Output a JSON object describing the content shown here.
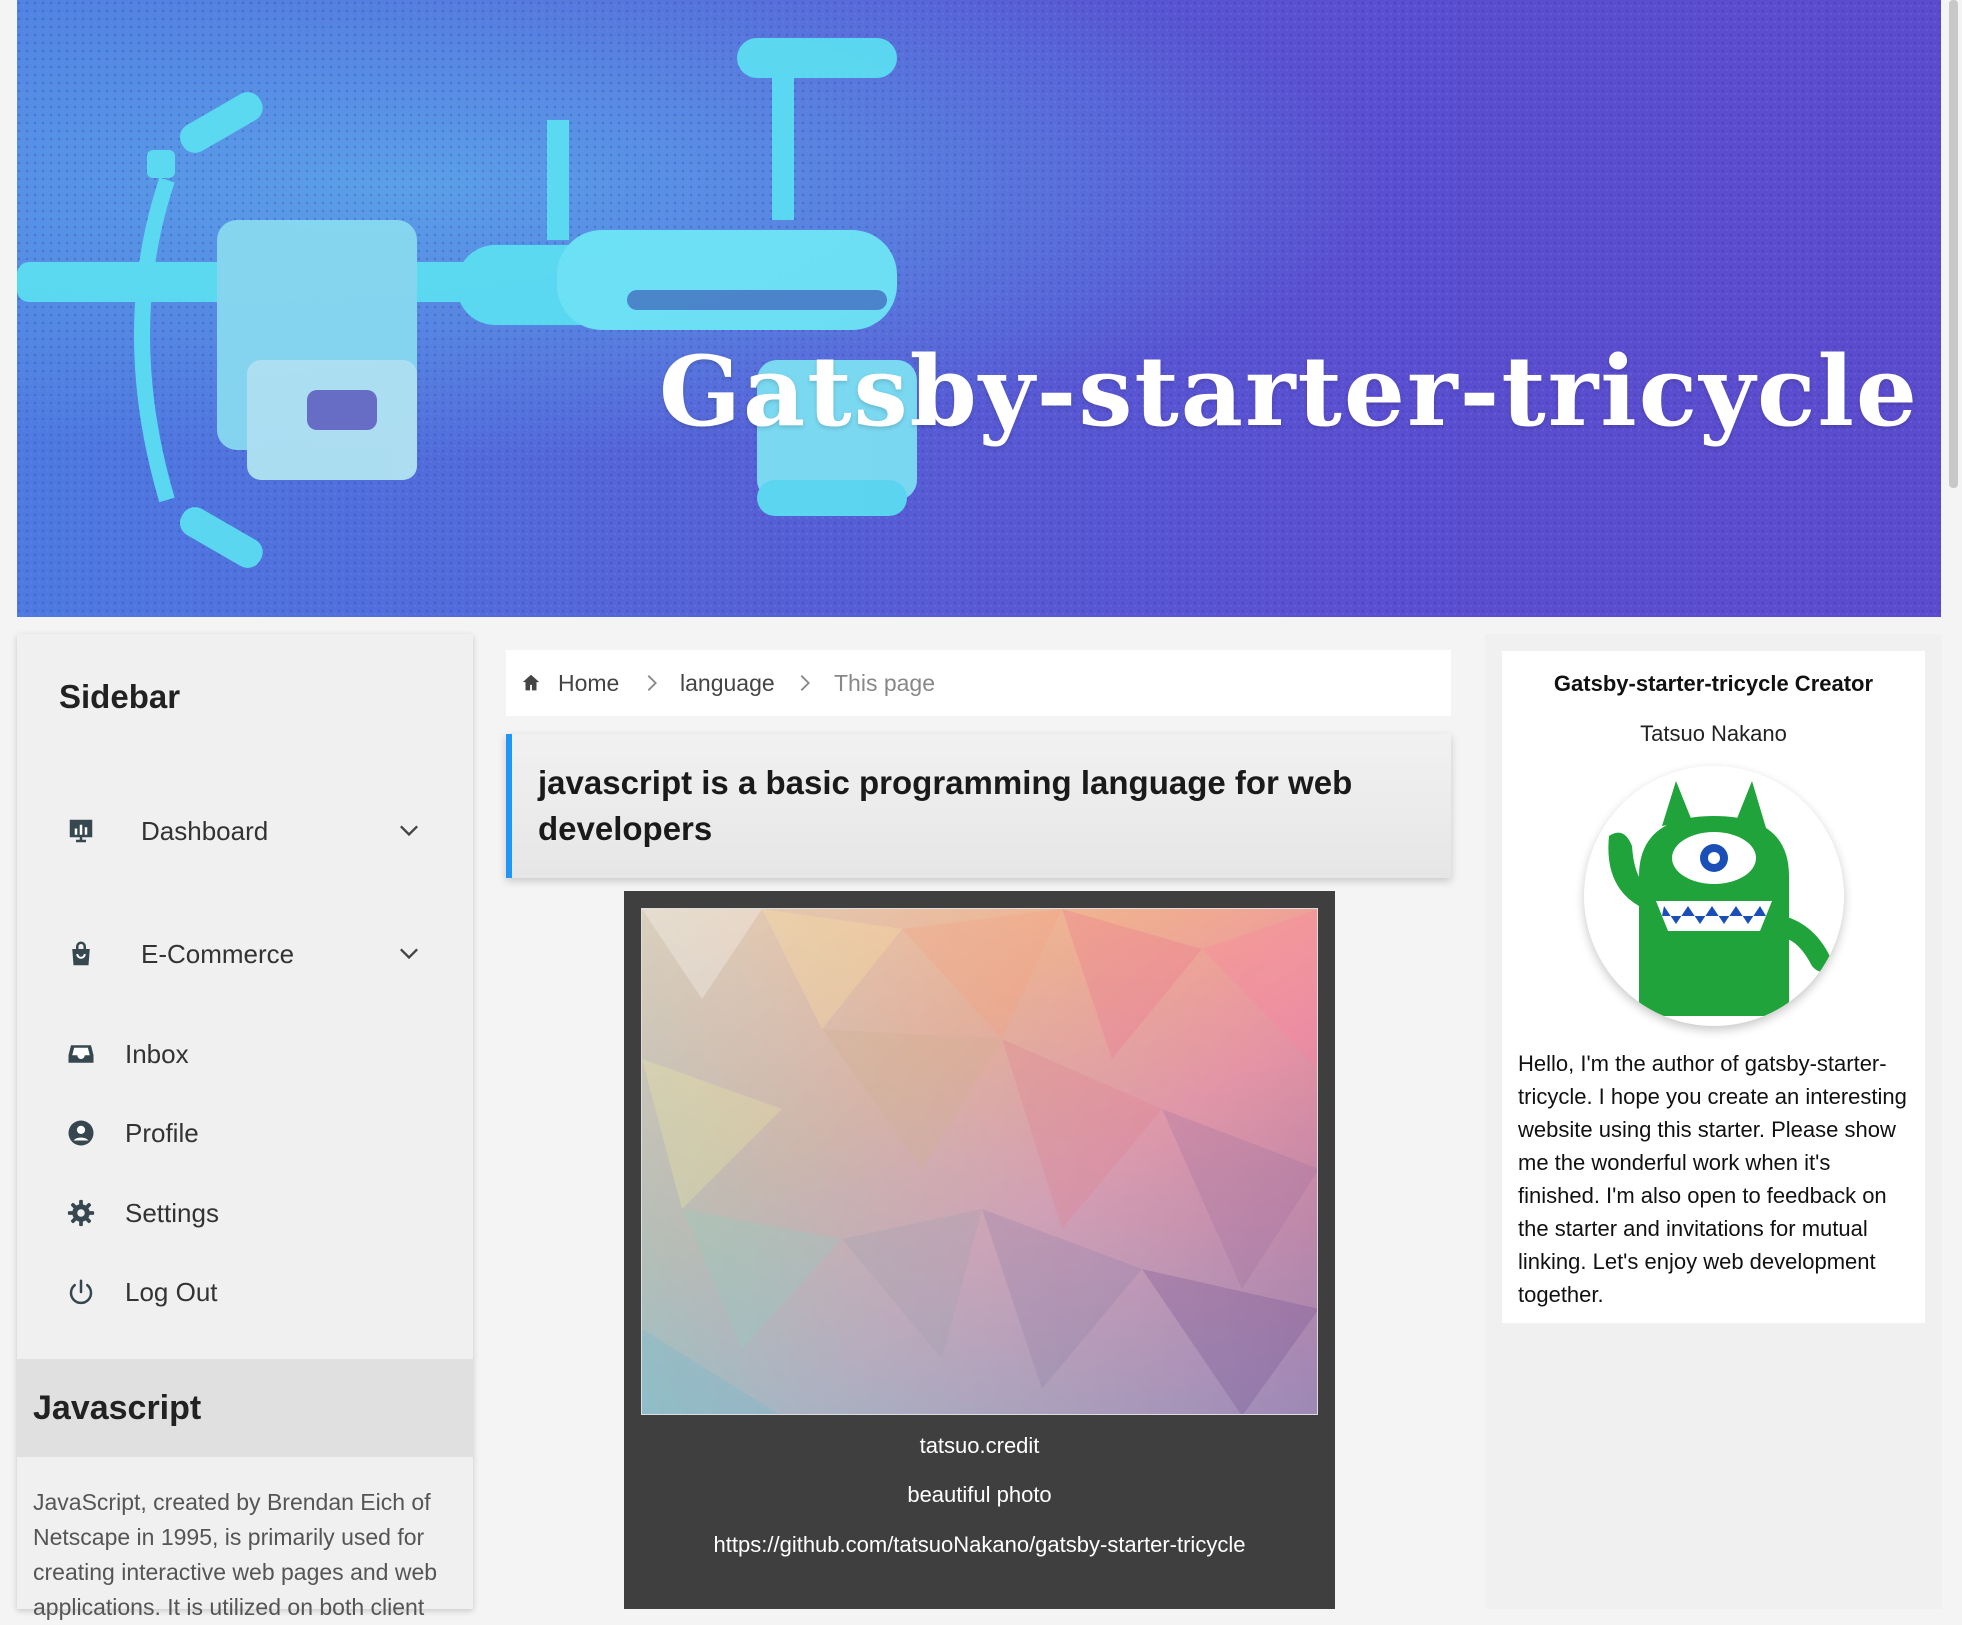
{
  "hero": {
    "title": "Gatsby-starter-tricycle"
  },
  "sidebar": {
    "title": "Sidebar",
    "items": [
      {
        "label": "Dashboard",
        "icon": "dashboard-icon",
        "expandable": true
      },
      {
        "label": "E-Commerce",
        "icon": "shopping-bag-icon",
        "expandable": true
      },
      {
        "label": "Inbox",
        "icon": "inbox-icon",
        "expandable": false
      },
      {
        "label": "Profile",
        "icon": "account-circle-icon",
        "expandable": false
      },
      {
        "label": "Settings",
        "icon": "gear-icon",
        "expandable": false
      },
      {
        "label": "Log Out",
        "icon": "power-icon",
        "expandable": false
      }
    ],
    "category": {
      "title": "Javascript",
      "description": "JavaScript, created by Brendan Eich of Netscape in 1995, is primarily used for creating interactive web pages and web applications. It is utilized on both client"
    }
  },
  "breadcrumb": {
    "items": [
      {
        "label": "Home"
      },
      {
        "label": "language"
      },
      {
        "label": "This page"
      }
    ]
  },
  "article": {
    "headline": "javascript is a basic programming language for web developers",
    "figure": {
      "credit": "tatsuo.credit",
      "caption": "beautiful photo",
      "link": "https://github.com/tatsuoNakano/gatsby-starter-tricycle"
    }
  },
  "profile": {
    "title": "Gatsby-starter-tricycle Creator",
    "name": "Tatsuo Nakano",
    "bio": "Hello, I'm the author of gatsby-starter-tricycle. I hope you create an interesting website using this starter. Please show me the wonderful work when it's finished. I'm also open to feedback on the starter and invitations for mutual linking. Let's enjoy web development together."
  },
  "colors": {
    "accent": "#2196f3",
    "hero_bg": "#5a4fd0",
    "figure_bg": "#3f3f3f"
  }
}
